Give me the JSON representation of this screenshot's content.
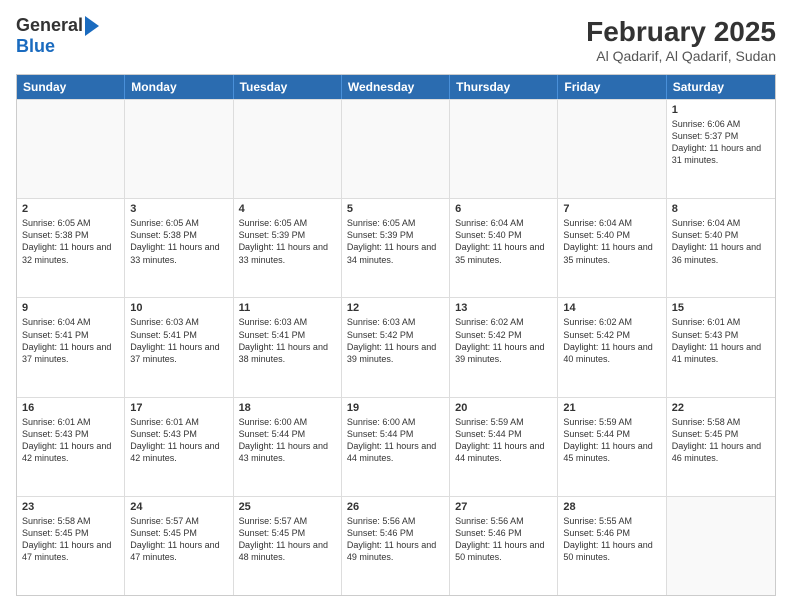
{
  "logo": {
    "line1": "General",
    "line2": "Blue"
  },
  "title": "February 2025",
  "subtitle": "Al Qadarif, Al Qadarif, Sudan",
  "days": [
    "Sunday",
    "Monday",
    "Tuesday",
    "Wednesday",
    "Thursday",
    "Friday",
    "Saturday"
  ],
  "weeks": [
    [
      {
        "day": "",
        "text": ""
      },
      {
        "day": "",
        "text": ""
      },
      {
        "day": "",
        "text": ""
      },
      {
        "day": "",
        "text": ""
      },
      {
        "day": "",
        "text": ""
      },
      {
        "day": "",
        "text": ""
      },
      {
        "day": "1",
        "text": "Sunrise: 6:06 AM\nSunset: 5:37 PM\nDaylight: 11 hours and 31 minutes."
      }
    ],
    [
      {
        "day": "2",
        "text": "Sunrise: 6:05 AM\nSunset: 5:38 PM\nDaylight: 11 hours and 32 minutes."
      },
      {
        "day": "3",
        "text": "Sunrise: 6:05 AM\nSunset: 5:38 PM\nDaylight: 11 hours and 33 minutes."
      },
      {
        "day": "4",
        "text": "Sunrise: 6:05 AM\nSunset: 5:39 PM\nDaylight: 11 hours and 33 minutes."
      },
      {
        "day": "5",
        "text": "Sunrise: 6:05 AM\nSunset: 5:39 PM\nDaylight: 11 hours and 34 minutes."
      },
      {
        "day": "6",
        "text": "Sunrise: 6:04 AM\nSunset: 5:40 PM\nDaylight: 11 hours and 35 minutes."
      },
      {
        "day": "7",
        "text": "Sunrise: 6:04 AM\nSunset: 5:40 PM\nDaylight: 11 hours and 35 minutes."
      },
      {
        "day": "8",
        "text": "Sunrise: 6:04 AM\nSunset: 5:40 PM\nDaylight: 11 hours and 36 minutes."
      }
    ],
    [
      {
        "day": "9",
        "text": "Sunrise: 6:04 AM\nSunset: 5:41 PM\nDaylight: 11 hours and 37 minutes."
      },
      {
        "day": "10",
        "text": "Sunrise: 6:03 AM\nSunset: 5:41 PM\nDaylight: 11 hours and 37 minutes."
      },
      {
        "day": "11",
        "text": "Sunrise: 6:03 AM\nSunset: 5:41 PM\nDaylight: 11 hours and 38 minutes."
      },
      {
        "day": "12",
        "text": "Sunrise: 6:03 AM\nSunset: 5:42 PM\nDaylight: 11 hours and 39 minutes."
      },
      {
        "day": "13",
        "text": "Sunrise: 6:02 AM\nSunset: 5:42 PM\nDaylight: 11 hours and 39 minutes."
      },
      {
        "day": "14",
        "text": "Sunrise: 6:02 AM\nSunset: 5:42 PM\nDaylight: 11 hours and 40 minutes."
      },
      {
        "day": "15",
        "text": "Sunrise: 6:01 AM\nSunset: 5:43 PM\nDaylight: 11 hours and 41 minutes."
      }
    ],
    [
      {
        "day": "16",
        "text": "Sunrise: 6:01 AM\nSunset: 5:43 PM\nDaylight: 11 hours and 42 minutes."
      },
      {
        "day": "17",
        "text": "Sunrise: 6:01 AM\nSunset: 5:43 PM\nDaylight: 11 hours and 42 minutes."
      },
      {
        "day": "18",
        "text": "Sunrise: 6:00 AM\nSunset: 5:44 PM\nDaylight: 11 hours and 43 minutes."
      },
      {
        "day": "19",
        "text": "Sunrise: 6:00 AM\nSunset: 5:44 PM\nDaylight: 11 hours and 44 minutes."
      },
      {
        "day": "20",
        "text": "Sunrise: 5:59 AM\nSunset: 5:44 PM\nDaylight: 11 hours and 44 minutes."
      },
      {
        "day": "21",
        "text": "Sunrise: 5:59 AM\nSunset: 5:44 PM\nDaylight: 11 hours and 45 minutes."
      },
      {
        "day": "22",
        "text": "Sunrise: 5:58 AM\nSunset: 5:45 PM\nDaylight: 11 hours and 46 minutes."
      }
    ],
    [
      {
        "day": "23",
        "text": "Sunrise: 5:58 AM\nSunset: 5:45 PM\nDaylight: 11 hours and 47 minutes."
      },
      {
        "day": "24",
        "text": "Sunrise: 5:57 AM\nSunset: 5:45 PM\nDaylight: 11 hours and 47 minutes."
      },
      {
        "day": "25",
        "text": "Sunrise: 5:57 AM\nSunset: 5:45 PM\nDaylight: 11 hours and 48 minutes."
      },
      {
        "day": "26",
        "text": "Sunrise: 5:56 AM\nSunset: 5:46 PM\nDaylight: 11 hours and 49 minutes."
      },
      {
        "day": "27",
        "text": "Sunrise: 5:56 AM\nSunset: 5:46 PM\nDaylight: 11 hours and 50 minutes."
      },
      {
        "day": "28",
        "text": "Sunrise: 5:55 AM\nSunset: 5:46 PM\nDaylight: 11 hours and 50 minutes."
      },
      {
        "day": "",
        "text": ""
      }
    ]
  ]
}
